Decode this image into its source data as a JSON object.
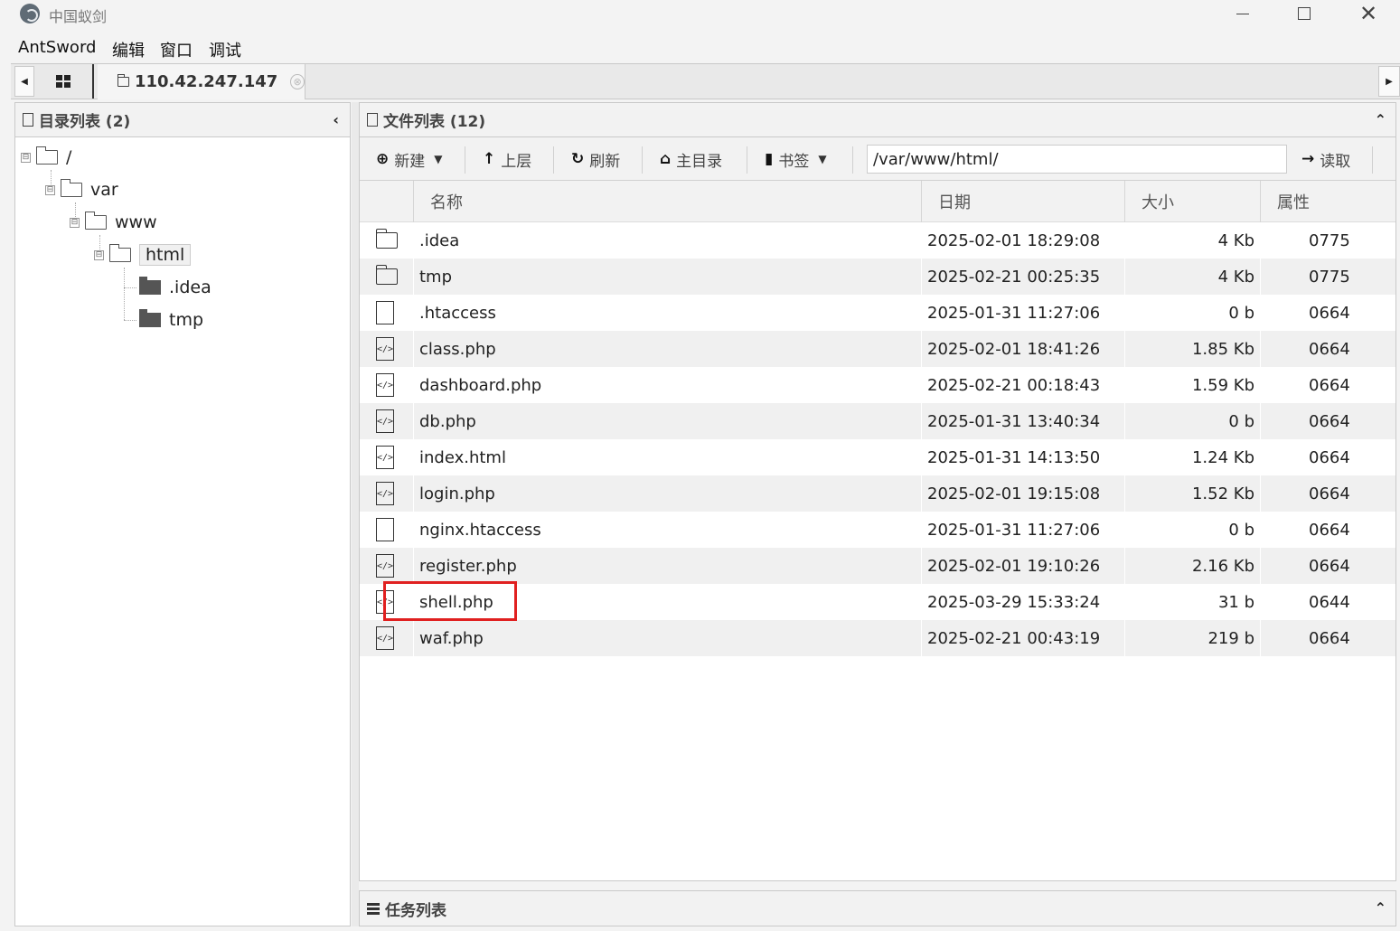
{
  "window": {
    "title": "中国蚁剑"
  },
  "menu": [
    "AntSword",
    "编辑",
    "窗口",
    "调试"
  ],
  "tabs": {
    "active_label": "110.42.247.147",
    "close_glyph": "⊗"
  },
  "left_panel": {
    "title": "目录列表 (2)",
    "collapse_glyph": "‹",
    "tree": [
      {
        "label": "/",
        "toggle": "⊟",
        "type": "open"
      },
      {
        "label": "var",
        "toggle": "⊟",
        "type": "open"
      },
      {
        "label": "www",
        "toggle": "⊟",
        "type": "open"
      },
      {
        "label": "html",
        "toggle": "⊟",
        "type": "open",
        "selected": true
      },
      {
        "label": ".idea",
        "type": "solid"
      },
      {
        "label": "tmp",
        "type": "solid"
      }
    ]
  },
  "right_panel": {
    "title": "文件列表 (12)",
    "toolbar": {
      "new_label": "新建",
      "up_label": "上层",
      "refresh_label": "刷新",
      "home_label": "主目录",
      "bookmark_label": "书签",
      "path_value": "/var/www/html/",
      "read_label": "读取"
    },
    "columns": {
      "name": "名称",
      "date": "日期",
      "size": "大小",
      "attr": "属性"
    },
    "files": [
      {
        "icon": "folder",
        "name": ".idea",
        "date": "2025-02-01 18:29:08",
        "size": "4 Kb",
        "perm": "0775"
      },
      {
        "icon": "folder",
        "name": "tmp",
        "date": "2025-02-21 00:25:35",
        "size": "4 Kb",
        "perm": "0775"
      },
      {
        "icon": "file",
        "name": ".htaccess",
        "date": "2025-01-31 11:27:06",
        "size": "0 b",
        "perm": "0664"
      },
      {
        "icon": "code",
        "name": "class.php",
        "date": "2025-02-01 18:41:26",
        "size": "1.85 Kb",
        "perm": "0664"
      },
      {
        "icon": "code",
        "name": "dashboard.php",
        "date": "2025-02-21 00:18:43",
        "size": "1.59 Kb",
        "perm": "0664"
      },
      {
        "icon": "code",
        "name": "db.php",
        "date": "2025-01-31 13:40:34",
        "size": "0 b",
        "perm": "0664"
      },
      {
        "icon": "code",
        "name": "index.html",
        "date": "2025-01-31 14:13:50",
        "size": "1.24 Kb",
        "perm": "0664"
      },
      {
        "icon": "code",
        "name": "login.php",
        "date": "2025-02-01 19:15:08",
        "size": "1.52 Kb",
        "perm": "0664"
      },
      {
        "icon": "file",
        "name": "nginx.htaccess",
        "date": "2025-01-31 11:27:06",
        "size": "0 b",
        "perm": "0664"
      },
      {
        "icon": "code",
        "name": "register.php",
        "date": "2025-02-01 19:10:26",
        "size": "2.16 Kb",
        "perm": "0664"
      },
      {
        "icon": "code",
        "name": "shell.php",
        "date": "2025-03-29 15:33:24",
        "size": "31 b",
        "perm": "0644"
      },
      {
        "icon": "code",
        "name": "waf.php",
        "date": "2025-02-21 00:43:19",
        "size": "219 b",
        "perm": "0664"
      }
    ]
  },
  "task_panel": {
    "title": "任务列表"
  },
  "colors": {
    "highlight": "#e02020",
    "row_alt": "#f0f0f0"
  }
}
